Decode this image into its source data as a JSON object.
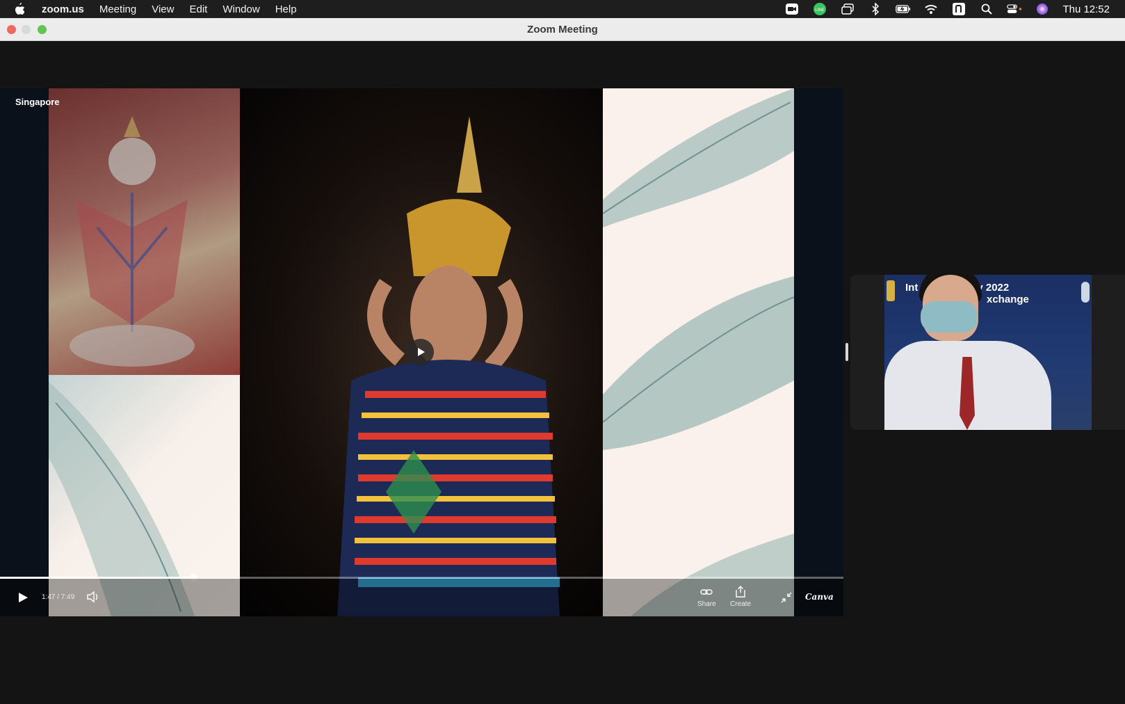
{
  "menubar": {
    "app_name": "zoom.us",
    "menus": [
      "Meeting",
      "View",
      "Edit",
      "Window",
      "Help"
    ],
    "status_icons": [
      "zoom-icon",
      "line-icon",
      "screen-mirror-icon",
      "bluetooth-icon",
      "battery-icon",
      "wifi-icon",
      "input-source-icon",
      "spotlight-icon",
      "control-center-icon",
      "siri-icon"
    ],
    "clock": "Thu 12:52"
  },
  "window": {
    "title": "Zoom Meeting"
  },
  "share": {
    "label": "Singapore",
    "video": {
      "time": "1:47 / 7:49",
      "progress": 0.229,
      "share_label": "Share",
      "create_label": "Create",
      "brand": "Canva"
    }
  },
  "participant": {
    "banner_line1": "Int      endship Day 2022",
    "banner_line2": "xchange"
  },
  "colors": {
    "accent_close": "#ed6a5e",
    "accent_max": "#61c554",
    "background": "#141414"
  }
}
